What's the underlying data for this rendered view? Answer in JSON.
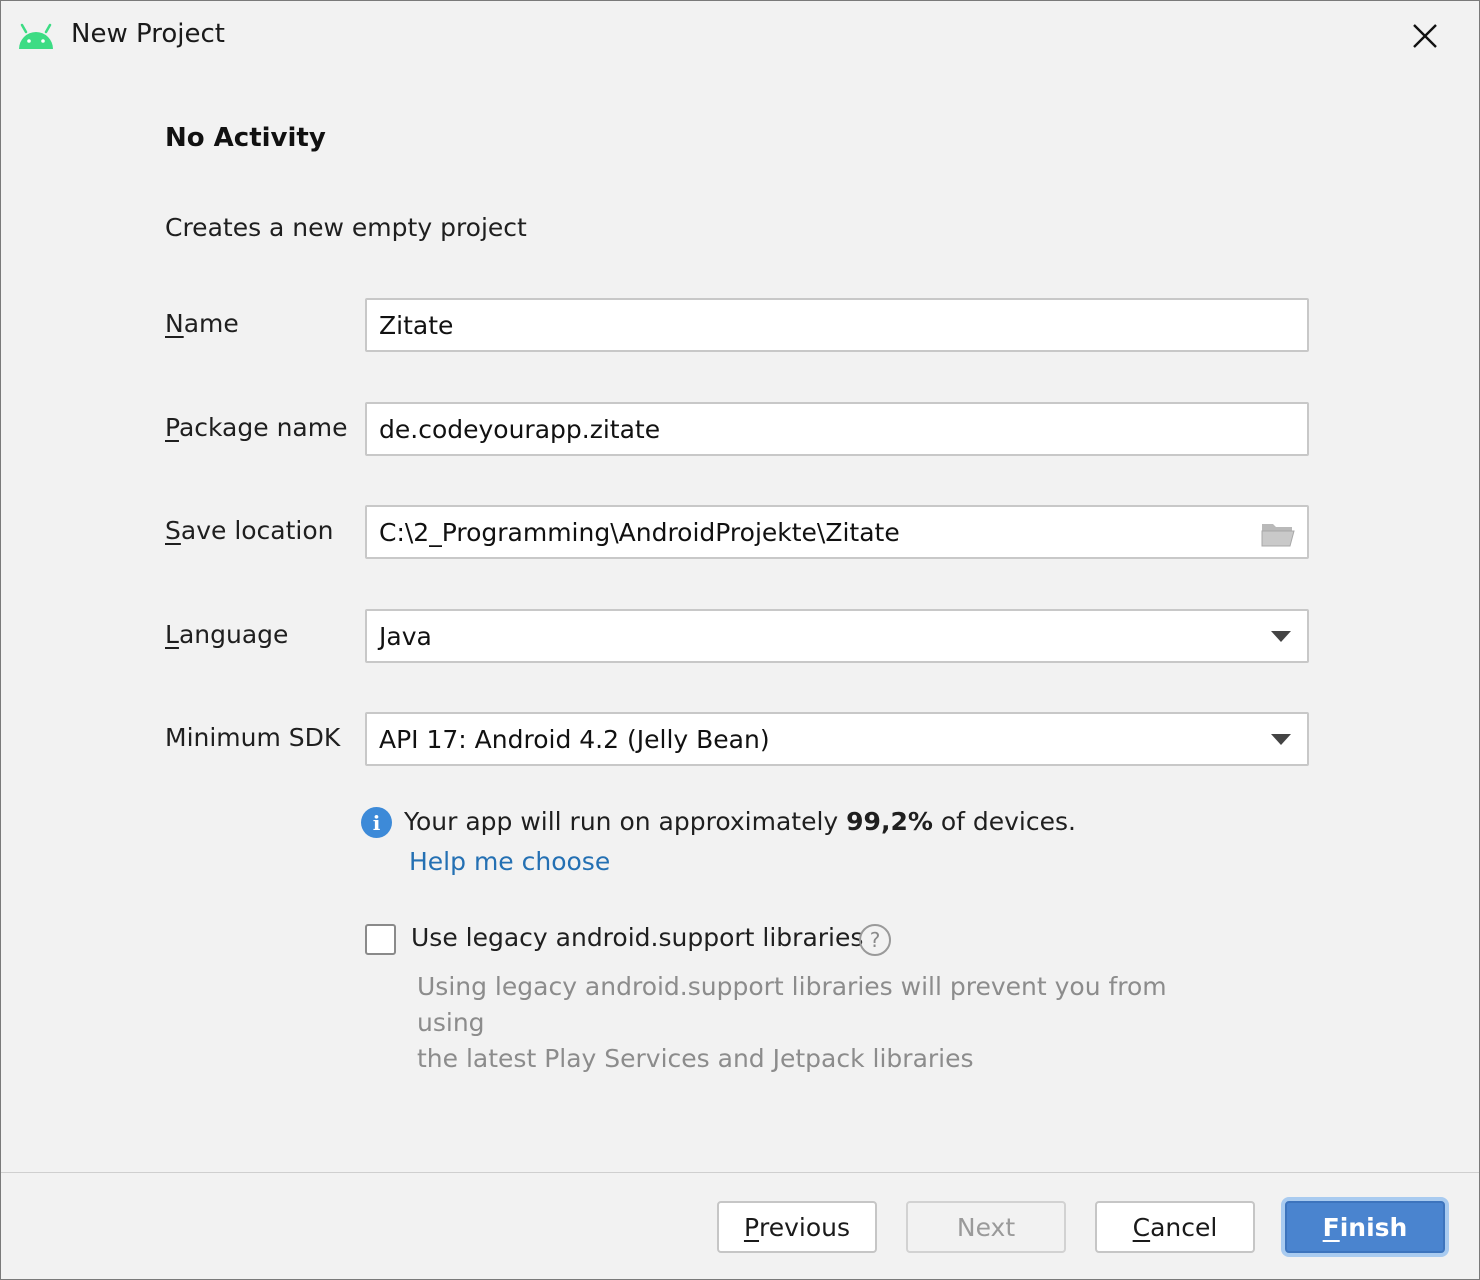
{
  "window": {
    "title": "New Project"
  },
  "main": {
    "heading": "No Activity",
    "subtitle": "Creates a new empty project",
    "fields": {
      "name": {
        "label_mnemonic": "N",
        "label_rest": "ame",
        "value": "Zitate"
      },
      "package": {
        "label_mnemonic": "P",
        "label_rest": "ackage name",
        "value": "de.codeyourapp.zitate"
      },
      "save_location": {
        "label_mnemonic": "S",
        "label_rest": "ave location",
        "value": "C:\\2_Programming\\AndroidProjekte\\Zitate"
      },
      "language": {
        "label_mnemonic": "L",
        "label_rest": "anguage",
        "value": "Java"
      },
      "min_sdk": {
        "label": "Minimum SDK",
        "value": "API 17: Android 4.2 (Jelly Bean)"
      }
    },
    "info": {
      "prefix": "Your app will run on approximately ",
      "percent": "99,2%",
      "suffix": " of devices.",
      "help_link": "Help me choose"
    },
    "legacy": {
      "checkbox_label": "Use legacy android.support libraries",
      "checked": false,
      "question_glyph": "?",
      "note_line1": "Using legacy android.support libraries will prevent you from using",
      "note_line2": "the latest Play Services and Jetpack libraries"
    }
  },
  "footer": {
    "previous": {
      "mnemonic": "P",
      "rest": "revious"
    },
    "next": "Next",
    "cancel": {
      "mnemonic": "C",
      "rest": "ancel"
    },
    "finish": {
      "mnemonic": "F",
      "rest": "inish"
    }
  },
  "colors": {
    "accent": "#4a84cf",
    "link": "#2470b3",
    "info_icon": "#3d8ad8",
    "android_green": "#3ddc84"
  },
  "icons": [
    "android-logo-icon",
    "close-icon",
    "folder-icon",
    "chevron-down-icon",
    "info-icon",
    "question-icon"
  ]
}
